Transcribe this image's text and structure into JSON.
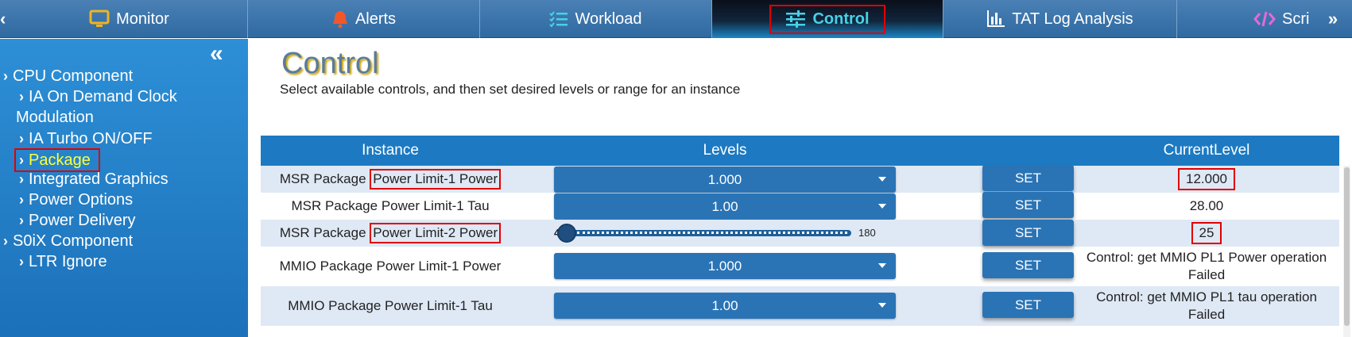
{
  "nav": {
    "tabs": [
      {
        "label": "Monitor",
        "icon": "monitor-icon"
      },
      {
        "label": "Alerts",
        "icon": "bell-icon"
      },
      {
        "label": "Workload",
        "icon": "list-check-icon"
      },
      {
        "label": "Control",
        "icon": "sliders-icon"
      },
      {
        "label": "TAT Log Analysis",
        "icon": "bar-chart-icon"
      },
      {
        "label": "Scri",
        "icon": "code-icon"
      }
    ],
    "right_arrow": "»",
    "left_arrow": "‹"
  },
  "sidebar": {
    "collapse": "«",
    "cpu": "CPU Component",
    "ia_clock_line1": "IA On Demand Clock",
    "ia_clock_line2": "Modulation",
    "ia_turbo": "IA Turbo ON/OFF",
    "package": "Package",
    "graphics": "Integrated Graphics",
    "power_options": "Power Options",
    "power_delivery": "Power Delivery",
    "s0ix": "S0iX Component",
    "ltr": "LTR Ignore"
  },
  "main": {
    "title": "Control",
    "subtitle": "Select available controls, and then set desired levels or range for an instance"
  },
  "table": {
    "headers": {
      "instance": "Instance",
      "levels": "Levels",
      "current": "CurrentLevel"
    },
    "set_label": "SET",
    "rows": [
      {
        "prefix": "MSR Package ",
        "boxed": "Power Limit-1 Power",
        "level": "1.000",
        "current": "12.000"
      },
      {
        "instance": "MSR Package Power Limit-1 Tau",
        "level": "1.00",
        "current": "28.00"
      },
      {
        "prefix": "MSR Package ",
        "boxed": "Power Limit-2 Power",
        "slider_min": "4",
        "slider_max": "180",
        "slider_value": 4,
        "current": "25"
      },
      {
        "instance": "MMIO Package Power Limit-1 Power",
        "level": "1.000",
        "current_line1": "Control: get MMIO PL1 Power operation",
        "current_line2": "Failed"
      },
      {
        "instance": "MMIO Package Power Limit-1 Tau",
        "level": "1.00",
        "current_line1": "Control: get MMIO PL1 tau operation",
        "current_line2": "Failed"
      }
    ]
  },
  "colors": {
    "nav": "#3a75ad",
    "sidebar": "#2488cf",
    "selected_text": "#ffff3a",
    "highlight": "#e00000",
    "active_tab_text": "#46d2e8",
    "header": "#1d7ac2"
  }
}
